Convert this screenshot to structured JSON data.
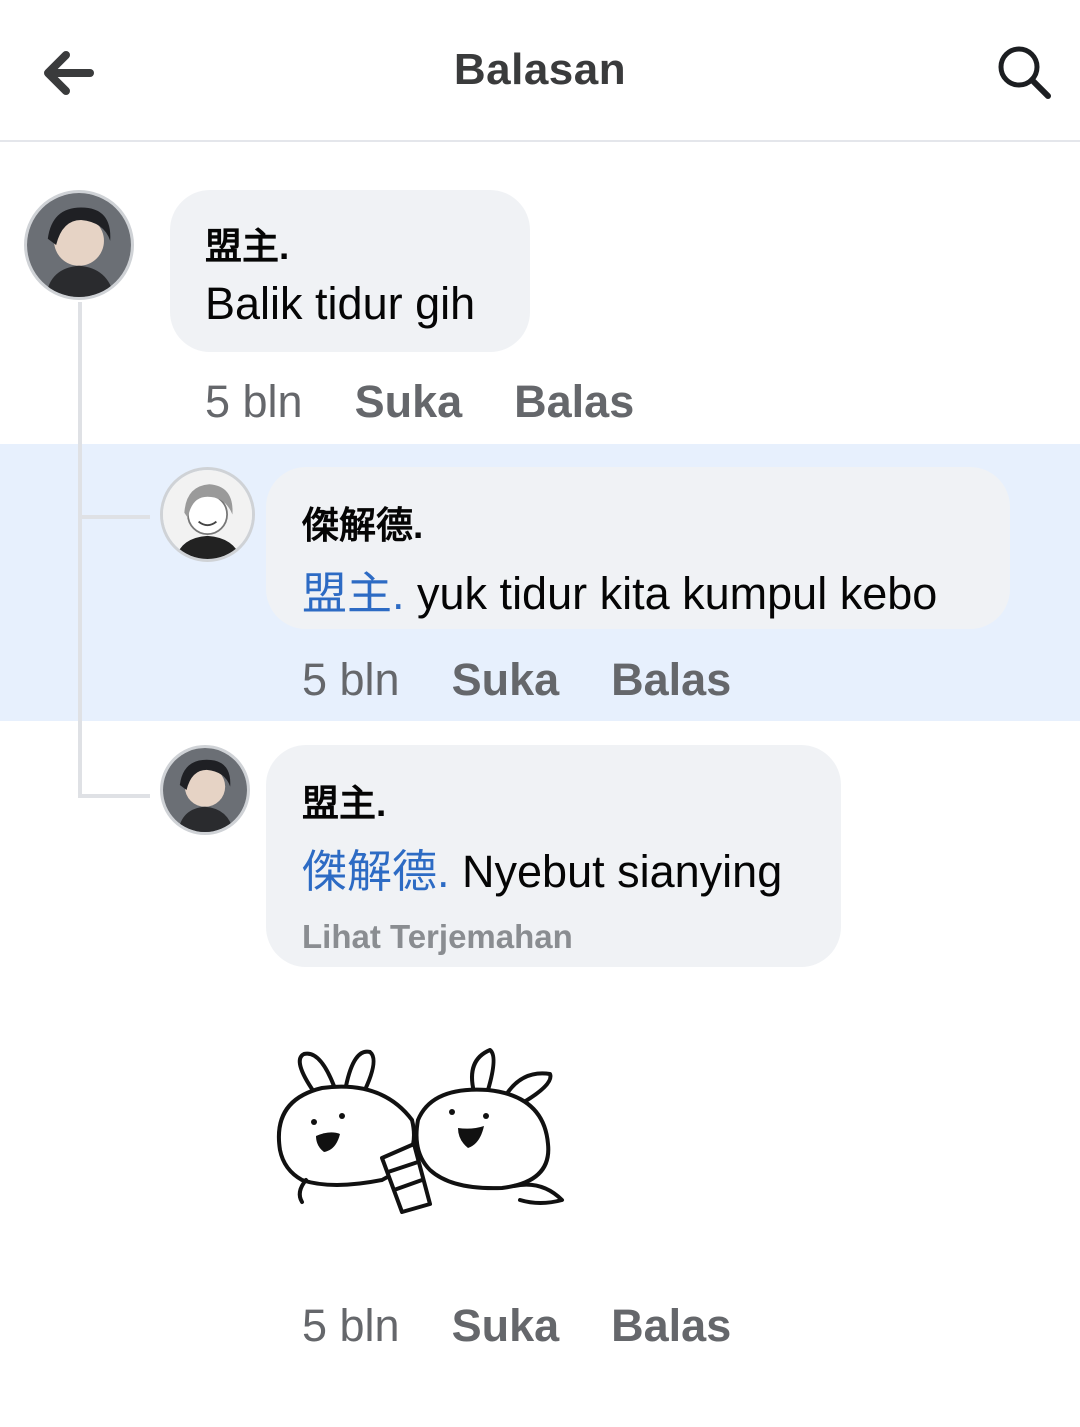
{
  "header": {
    "title": "Balasan",
    "back_icon": "arrow-left-icon",
    "search_icon": "search-icon"
  },
  "comments": [
    {
      "author": "盟主.",
      "text": "Balik tidur gih",
      "time": "5 bln",
      "like": "Suka",
      "reply": "Balas"
    },
    {
      "author": "傑解德.",
      "mention": "盟主.",
      "text": "yuk tidur kita kumpul kebo",
      "time": "5 bln",
      "like": "Suka",
      "reply": "Balas"
    },
    {
      "author": "盟主.",
      "mention": "傑解德.",
      "text": "Nyebut sianying",
      "translate": "Lihat Terjemahan",
      "time": "5 bln",
      "like": "Suka",
      "reply": "Balas"
    }
  ],
  "colors": {
    "highlight_bg": "#e7f0fd",
    "bubble_bg": "#f0f2f5",
    "mention": "#2d6bc4"
  }
}
